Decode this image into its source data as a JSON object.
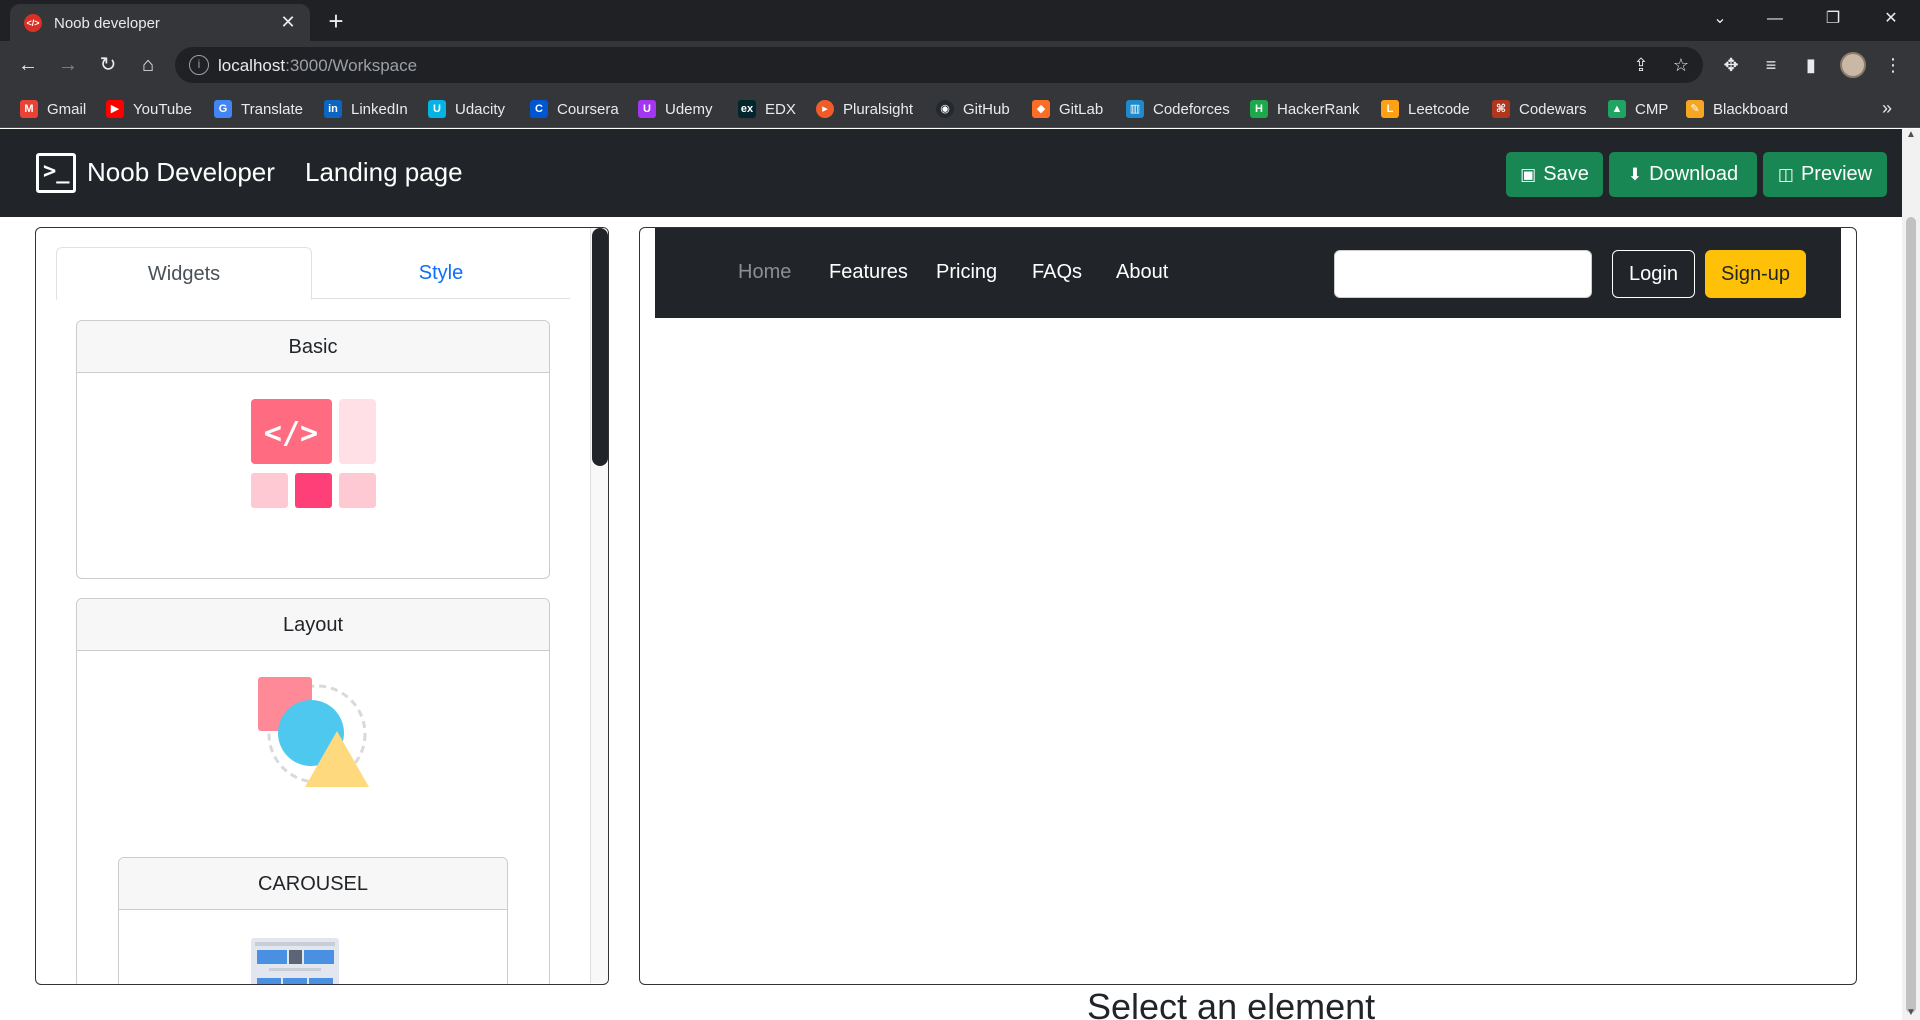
{
  "browser": {
    "tab_title": "Noob developer",
    "url_host": "localhost",
    "url_path": ":3000/Workspace",
    "bookmarks": [
      {
        "label": "Gmail",
        "icon": "gmail-icon",
        "color": "#ea4335"
      },
      {
        "label": "YouTube",
        "icon": "youtube-icon",
        "color": "#ff0000"
      },
      {
        "label": "Translate",
        "icon": "translate-icon",
        "color": "#4285f4"
      },
      {
        "label": "LinkedIn",
        "icon": "linkedin-icon",
        "color": "#0a66c2"
      },
      {
        "label": "Udacity",
        "icon": "udacity-icon",
        "color": "#02b3e4"
      },
      {
        "label": "Coursera",
        "icon": "coursera-icon",
        "color": "#0056d2"
      },
      {
        "label": "Udemy",
        "icon": "udemy-icon",
        "color": "#a435f0"
      },
      {
        "label": "EDX",
        "icon": "edx-icon",
        "color": "#02262b"
      },
      {
        "label": "Pluralsight",
        "icon": "pluralsight-icon",
        "color": "#f15b2a"
      },
      {
        "label": "GitHub",
        "icon": "github-icon",
        "color": "#24292f"
      },
      {
        "label": "GitLab",
        "icon": "gitlab-icon",
        "color": "#fc6d26"
      },
      {
        "label": "Codeforces",
        "icon": "codeforces-icon",
        "color": "#1f8acb"
      },
      {
        "label": "HackerRank",
        "icon": "hackerrank-icon",
        "color": "#1ba94c"
      },
      {
        "label": "Leetcode",
        "icon": "leetcode-icon",
        "color": "#ffa116"
      },
      {
        "label": "Codewars",
        "icon": "codewars-icon",
        "color": "#b1361e"
      },
      {
        "label": "CMP",
        "icon": "google-drive-icon",
        "color": "#1fa463"
      },
      {
        "label": "Blackboard",
        "icon": "blackboard-icon",
        "color": "#f5a623"
      }
    ]
  },
  "header": {
    "brand": "Noob Developer",
    "page": "Landing page",
    "save_label": "Save",
    "download_label": "Download",
    "preview_label": "Preview",
    "button_color": "#198754"
  },
  "sidebar": {
    "tabs": [
      "Widgets",
      "Style"
    ],
    "sections": {
      "basic": "Basic",
      "layout": "Layout",
      "carousel": "CAROUSEL"
    }
  },
  "preview": {
    "nav_links": [
      "Home",
      "Features",
      "Pricing",
      "FAQs",
      "About"
    ],
    "login_label": "Login",
    "signup_label": "Sign-up",
    "signup_color": "#ffc107"
  },
  "footer_text": "Select an element"
}
